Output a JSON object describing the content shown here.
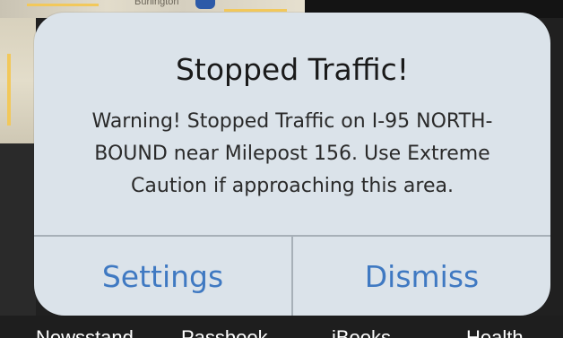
{
  "background": {
    "map_town_label": "Burlington",
    "dock_labels": [
      "Newsstand",
      "Passbook",
      "iBooks",
      "Health"
    ]
  },
  "alert": {
    "title": "Stopped Traffic!",
    "message": "Warning! Stopped Traffic on I-95 NORTH-BOUND near Milepost 156. Use Extreme Caution if approaching this area.",
    "buttons": {
      "settings_label": "Settings",
      "dismiss_label": "Dismiss"
    }
  },
  "colors": {
    "alert_background": "#dbe3ea",
    "button_text": "#3f79c2",
    "title_text": "#1a1a1a"
  },
  "icons": {
    "map_route_shield": "interstate-shield-icon"
  }
}
